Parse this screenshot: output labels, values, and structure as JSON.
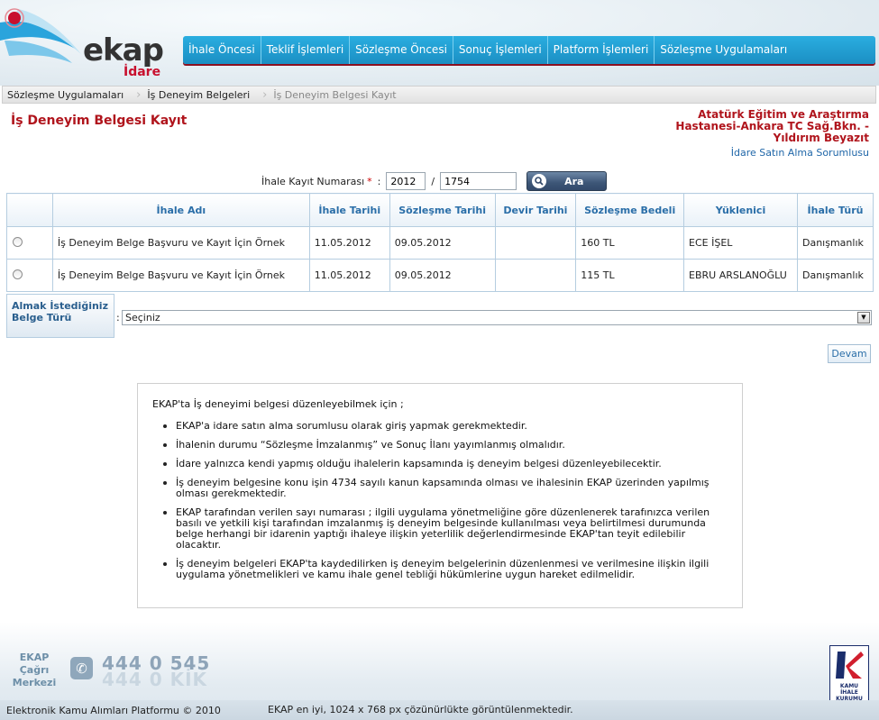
{
  "colors": {
    "brand_red": "#b0141c",
    "nav_blue": "#1b8fc3",
    "link_blue": "#1f66a8",
    "header_blue": "#2a6ea8"
  },
  "logo": {
    "text": "ekap",
    "subtitle": "İdare"
  },
  "nav": {
    "items": [
      "İhale Öncesi",
      "Teklif İşlemleri",
      "Sözleşme Öncesi",
      "Sonuç İşlemleri",
      "Platform İşlemleri",
      "Sözleşme Uygulamaları"
    ]
  },
  "breadcrumb": [
    "Sözleşme Uygulamaları",
    "İş Deneyim Belgeleri",
    "İş Deneyim Belgesi Kayıt"
  ],
  "page": {
    "title": "İş Deneyim Belgesi Kayıt"
  },
  "org": {
    "name": "Atatürk Eğitim ve Araştırma Hastanesi-Ankara TC Sağ.Bkn. -Yıldırım Beyazıt",
    "role": "İdare Satın Alma Sorumlusu"
  },
  "search": {
    "label": "İhale Kayıt Numarası",
    "required_mark": "*",
    "year": "2012",
    "number": "1754",
    "button_label": "Ara",
    "button_icon": "search-icon"
  },
  "table": {
    "headers": [
      "",
      "İhale Adı",
      "İhale Tarihi",
      "Sözleşme Tarihi",
      "Devir Tarihi",
      "Sözleşme Bedeli",
      "Yüklenici",
      "İhale Türü"
    ],
    "rows": [
      [
        "",
        "İş Deneyim Belge Başvuru ve Kayıt İçin Örnek",
        "11.05.2012",
        "09.05.2012",
        "",
        "160 TL",
        "ECE İŞEL",
        "Danışmanlık"
      ],
      [
        "",
        "İş Deneyim Belge Başvuru ve Kayıt İçin Örnek",
        "11.05.2012",
        "09.05.2012",
        "",
        "115 TL",
        "EBRU ARSLANOĞLU",
        "Danışmanlık"
      ]
    ]
  },
  "belge": {
    "label": "Almak İstediğiniz Belge Türü",
    "selected": "Seçiniz"
  },
  "continue_label": "Devam",
  "info": {
    "title": "EKAP'ta İş deneyimi belgesi düzenleyebilmek için ;",
    "items": [
      "EKAP'a idare satın alma sorumlusu olarak giriş yapmak gerekmektedir.",
      "İhalenin durumu “Sözleşme İmzalanmış” ve Sonuç İlanı yayımlanmış olmalıdır.",
      "İdare yalnızca kendi yapmış olduğu ihalelerin kapsamında iş deneyim belgesi düzenleyebilecektir.",
      "İş deneyim belgesine konu işin 4734 sayılı kanun kapsamında olması ve ihalesinin EKAP üzerinden yapılmış olması gerekmektedir.",
      "EKAP tarafından verilen sayı numarası ; ilgili uygulama yönetmeliğine göre düzenlenerek tarafınızca verilen basılı ve yetkili kişi tarafından imzalanmış iş deneyim belgesinde kullanılması veya belirtilmesi durumunda belge herhangi bir idarenin yaptığı ihaleye ilişkin yeterlilik değerlendirmesinde EKAP'tan teyit edilebilir olacaktır.",
      "İş deneyim belgeleri EKAP'ta kaydedilirken iş deneyim belgelerinin düzenlenmesi ve verilmesine ilişkin ilgili uygulama yönetmelikleri ve kamu ihale genel tebliği hükümlerine uygun hareket edilmelidir."
    ]
  },
  "footer": {
    "call_center": "EKAP Çağrı Merkezi",
    "phone": "444 0 545",
    "phone_alt": "444 0 KİK",
    "kik_label": "KAMU İHALE KURUMU",
    "copyright": "Elektronik Kamu Alımları Platformu © 2010",
    "resolution_note": "EKAP en iyi, 1024 x 768 px çözünürlükte görüntülenmektedir."
  }
}
